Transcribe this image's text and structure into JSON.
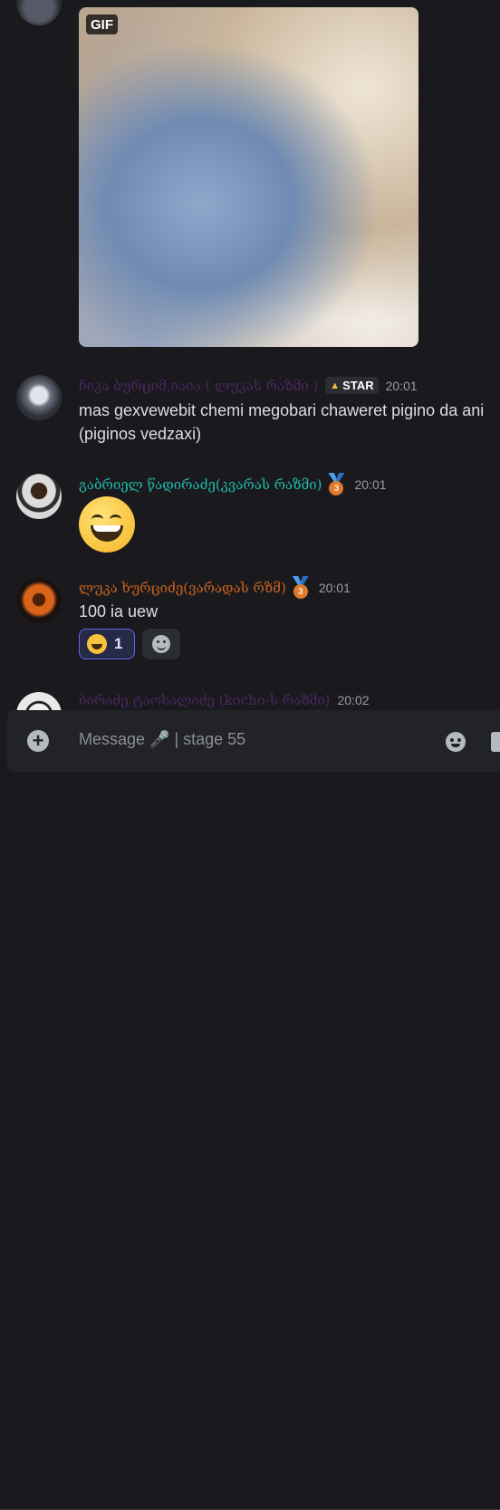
{
  "messages": [
    {
      "media_badge": "GIF"
    },
    {
      "author": "ჩიკა ბურციმ,იაია ( ლუკას რაზმი )",
      "tag": "STAR",
      "time": "20:01",
      "text": "mas gexvewebit chemi megobari chaweret pigino da ani (piginos vedzaxi)"
    },
    {
      "author": "გაბრიელ წადირაძე(კვარას რაზმი)",
      "medal": "3",
      "time": "20:01",
      "content_emoji": "laughing-face"
    },
    {
      "author": "ლუკა ხურციძე(ვარადას რზმ)",
      "medal": "3",
      "time": "20:01",
      "text": "100 ia uew",
      "reaction": {
        "emoji": "laughing-face",
        "count": "1"
      }
    },
    {
      "author": "ბირაძე ტაოსალიძე (kocho-ს რაზმი)",
      "time": "20:02"
    }
  ],
  "composer": {
    "placeholder": "Message 🎤 | stage 55"
  },
  "colors": {
    "background": "#1a1a1e",
    "composer_bg": "#222327",
    "accent": "#5865f2",
    "name_teal": "#1fb7a9",
    "name_orange": "#c8621d",
    "name_purple": "#4b2560"
  }
}
